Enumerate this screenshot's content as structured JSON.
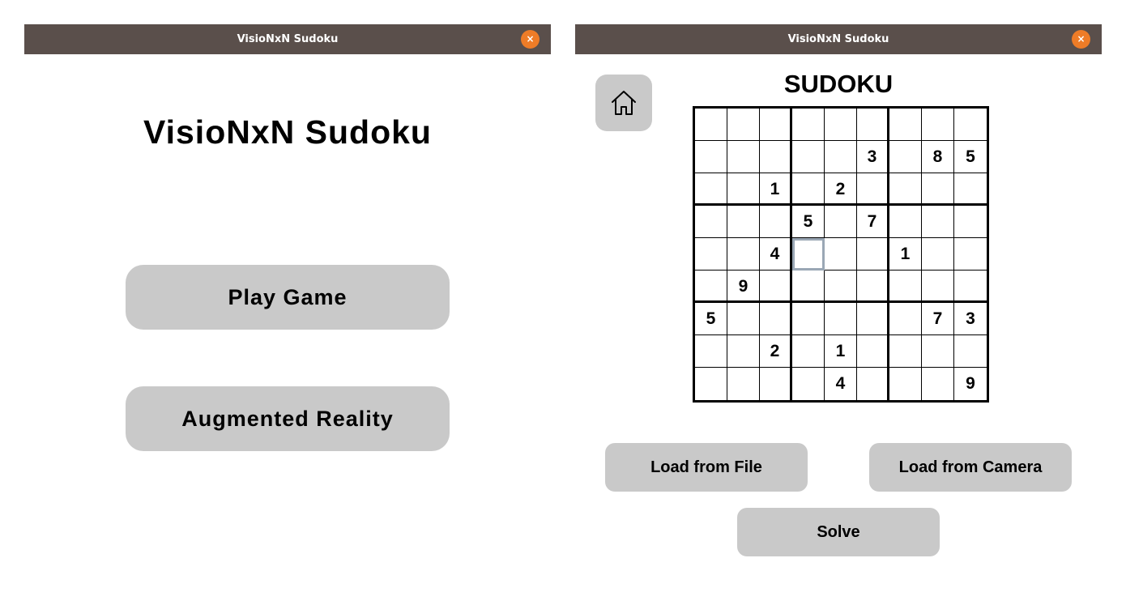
{
  "left_window": {
    "title": "VisioNxN Sudoku",
    "close_symbol": "×",
    "heading": "VisioNxN Sudoku",
    "play_button": "Play Game",
    "ar_button": "Augmented Reality"
  },
  "right_window": {
    "title": "VisioNxN Sudoku",
    "close_symbol": "×",
    "heading": "SUDOKU",
    "home_icon": "home-icon",
    "board": [
      [
        "",
        "",
        "",
        "",
        "",
        "",
        "",
        "",
        ""
      ],
      [
        "",
        "",
        "",
        "",
        "",
        "3",
        "",
        "8",
        "5"
      ],
      [
        "",
        "",
        "1",
        "",
        "2",
        "",
        "",
        "",
        ""
      ],
      [
        "",
        "",
        "",
        "5",
        "",
        "7",
        "",
        "",
        ""
      ],
      [
        "",
        "",
        "4",
        "",
        "",
        "",
        "1",
        "",
        ""
      ],
      [
        "",
        "9",
        "",
        "",
        "",
        "",
        "",
        "",
        ""
      ],
      [
        "5",
        "",
        "",
        "",
        "",
        "",
        "",
        "7",
        "3"
      ],
      [
        "",
        "",
        "2",
        "",
        "1",
        "",
        "",
        "",
        ""
      ],
      [
        "",
        "",
        "",
        "",
        "4",
        "",
        "",
        "",
        "9"
      ]
    ],
    "selected_cell": [
      4,
      3
    ],
    "load_file_button": "Load from File",
    "load_camera_button": "Load from Camera",
    "solve_button": "Solve"
  },
  "colors": {
    "titlebar": "#5a4f4b",
    "close_button": "#ee7c27",
    "button_gray": "#c9c9c9",
    "selected_cell_outline": "#9aa7b5"
  }
}
